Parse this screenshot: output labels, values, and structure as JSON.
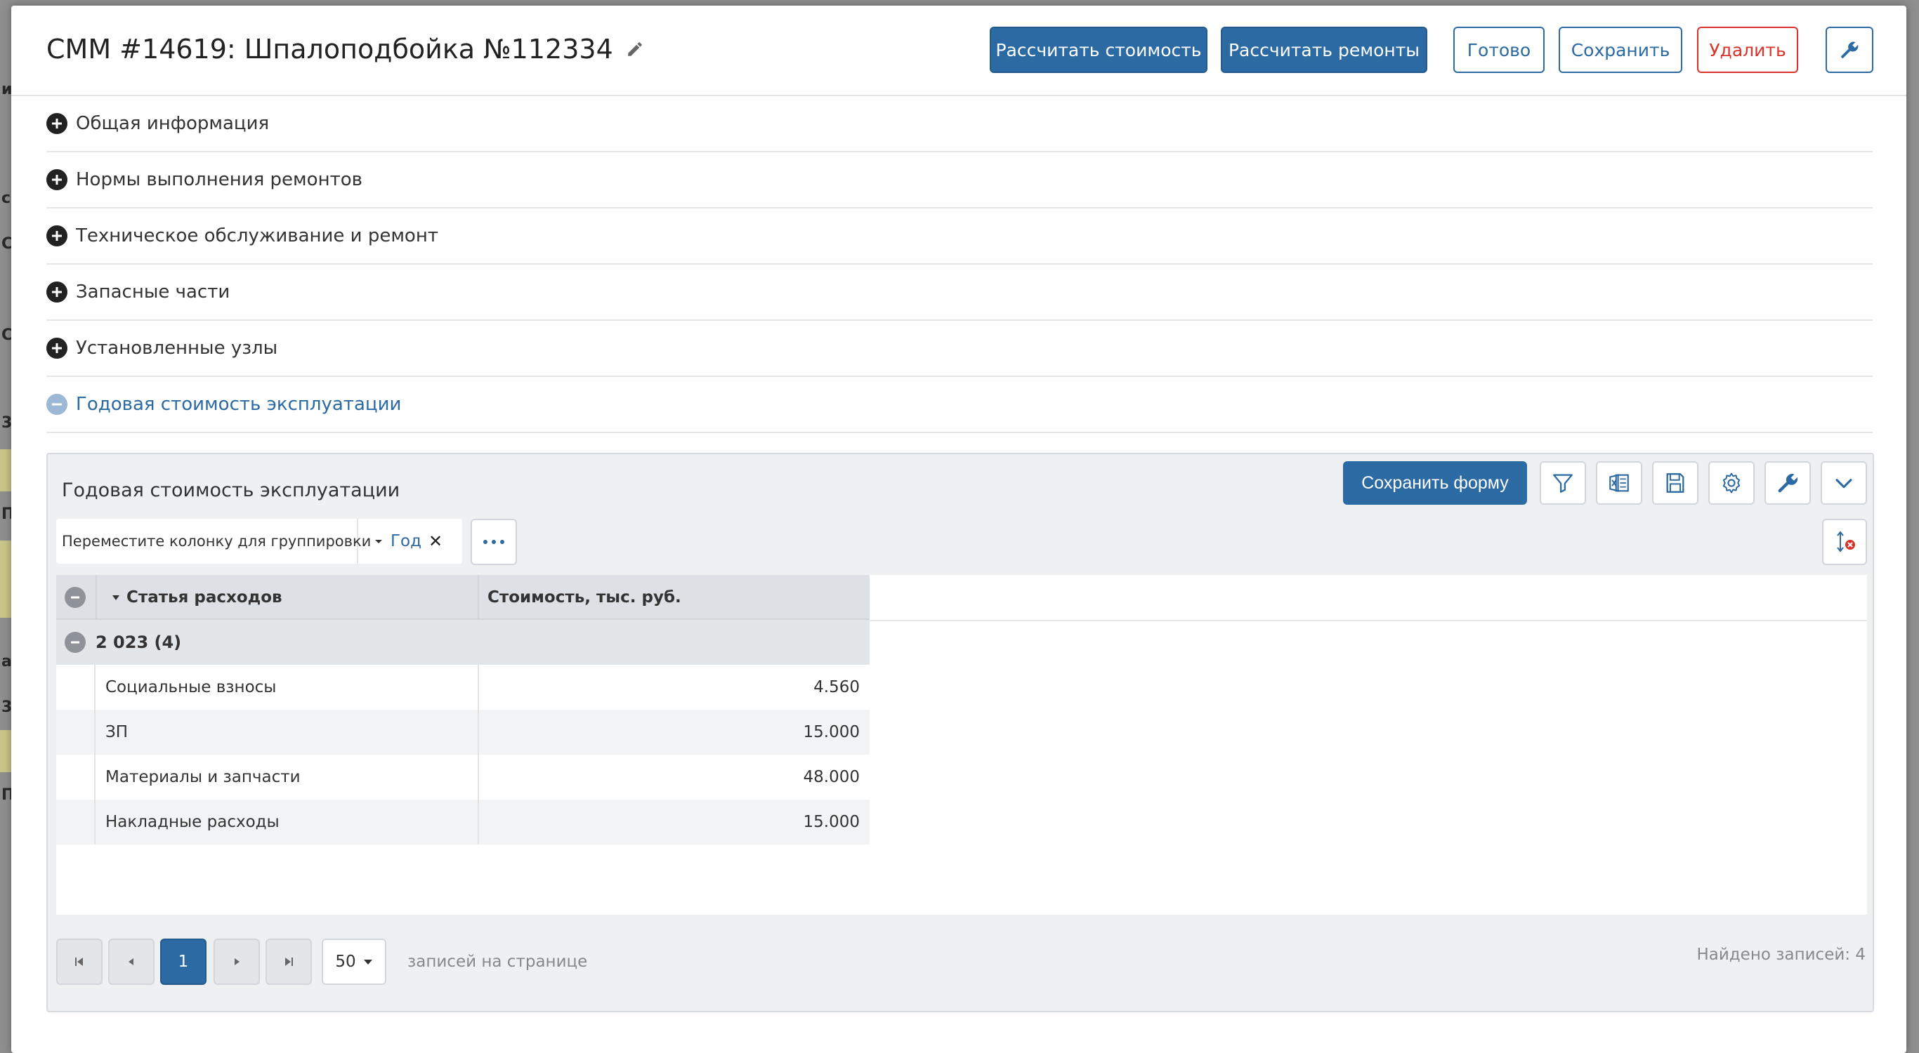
{
  "background": {
    "letters": [
      "и",
      "с",
      "С",
      "С",
      "3",
      "П",
      "а",
      "3",
      "П"
    ]
  },
  "header": {
    "title": "СММ #14619: Шпалоподбойка №112334",
    "buttons": {
      "calc_cost": "Рассчитать стоимость",
      "calc_repairs": "Рассчитать ремонты",
      "done": "Готово",
      "save": "Сохранить",
      "delete": "Удалить"
    }
  },
  "sections": [
    {
      "label": "Общая информация",
      "expanded": false
    },
    {
      "label": "Нормы выполнения ремонтов",
      "expanded": false
    },
    {
      "label": "Техническое обслуживание и ремонт",
      "expanded": false
    },
    {
      "label": "Запасные части",
      "expanded": false
    },
    {
      "label": "Установленные узлы",
      "expanded": false
    },
    {
      "label": "Годовая стоимость эксплуатации",
      "expanded": true
    }
  ],
  "panel": {
    "title": "Годовая стоимость эксплуатации",
    "save_form": "Сохранить форму",
    "group_hint": "Переместите колонку для группировки",
    "group_chip": "Год",
    "chip_close": "✕",
    "more": "···"
  },
  "grid": {
    "columns": [
      "Статья расходов",
      "Стоимость, тыс. руб."
    ],
    "group": {
      "label": "2 023 (4)"
    },
    "rows": [
      {
        "name": "Социальные взносы",
        "value": "4.560"
      },
      {
        "name": "ЗП",
        "value": "15.000"
      },
      {
        "name": "Материалы и запчасти",
        "value": "48.000"
      },
      {
        "name": "Накладные расходы",
        "value": "15.000"
      }
    ]
  },
  "pager": {
    "current_page": "1",
    "per_page": "50",
    "per_page_label": "записей на странице",
    "found": "Найдено записей: 4"
  },
  "colors": {
    "primary": "#2c6aa3",
    "danger": "#d9342c",
    "panel_bg": "#eef0f2"
  }
}
